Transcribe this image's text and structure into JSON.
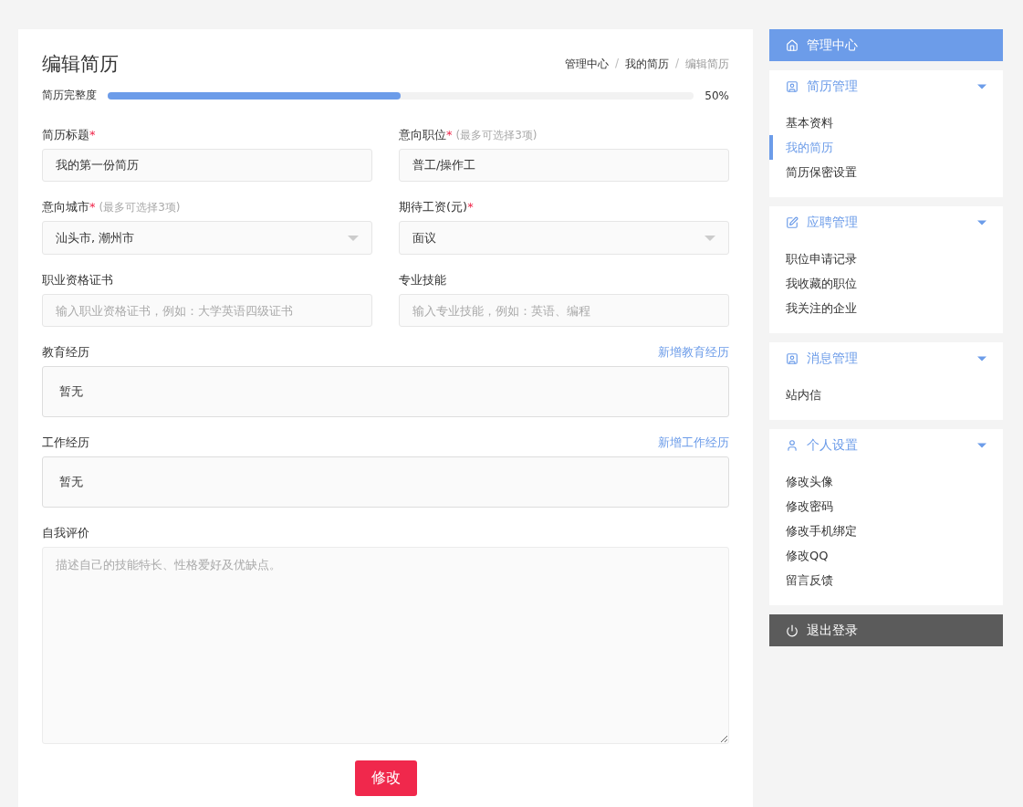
{
  "page_title": "编辑简历",
  "breadcrumb": [
    {
      "label": "管理中心",
      "selected": false
    },
    {
      "label": "我的简历",
      "selected": false
    },
    {
      "label": "编辑简历",
      "selected": true
    }
  ],
  "breadcrumb_separator": "/",
  "progress": {
    "label": "简历完整度",
    "level": 0.5,
    "reading": "50%"
  },
  "fields": [
    {
      "kind": "input",
      "label": "简历标题",
      "required_mark": "*",
      "value": "我的第一份简历"
    },
    {
      "kind": "input",
      "label": "意向职位",
      "required_mark": "*",
      "hint": "(最多可选择3项)",
      "value": "普工/操作工"
    },
    {
      "kind": "select",
      "label": "意向城市",
      "required_mark": "*",
      "hint": "(最多可选择3项)",
      "value": "汕头市, 潮州市"
    },
    {
      "kind": "select",
      "label": "期待工资(元)",
      "required_mark": "*",
      "value": "面议"
    },
    {
      "kind": "input",
      "label": "职业资格证书",
      "placeholder": "输入职业资格证书，例如：大学英语四级证书"
    },
    {
      "kind": "input",
      "label": "专业技能",
      "placeholder": "输入专业技能，例如：英语、编程"
    }
  ],
  "sections": [
    {
      "label": "教育经历",
      "action": "新增教育经历",
      "content": "暂无"
    },
    {
      "label": "工作经历",
      "action": "新增工作经历",
      "content": "暂无"
    }
  ],
  "self_review": {
    "label": "自我评价",
    "placeholder": "描述自己的技能特长、性格爱好及优缺点。"
  },
  "submit": "修改",
  "sidebar": {
    "header": {
      "kind": "home",
      "label": "管理中心"
    },
    "groups": [
      {
        "kind": "card",
        "label": "简历管理",
        "expanded": true,
        "items": [
          {
            "label": "基本资料",
            "selected": false
          },
          {
            "label": "我的简历",
            "selected": true
          },
          {
            "label": "简历保密设置",
            "selected": false
          }
        ]
      },
      {
        "kind": "edit",
        "label": "应聘管理",
        "expanded": true,
        "items": [
          {
            "label": "职位申请记录",
            "selected": false
          },
          {
            "label": "我收藏的职位",
            "selected": false
          },
          {
            "label": "我关注的企业",
            "selected": false
          }
        ]
      },
      {
        "kind": "card",
        "label": "消息管理",
        "expanded": true,
        "items": [
          {
            "label": "站内信",
            "selected": false
          }
        ]
      },
      {
        "kind": "user",
        "label": "个人设置",
        "expanded": true,
        "items": [
          {
            "label": "修改头像",
            "selected": false
          },
          {
            "label": "修改密码",
            "selected": false
          },
          {
            "label": "修改手机绑定",
            "selected": false
          },
          {
            "label": "修改QQ",
            "selected": false
          },
          {
            "label": "留言反馈",
            "selected": false
          }
        ]
      }
    ],
    "logout": {
      "kind": "power",
      "label": "退出登录"
    }
  }
}
